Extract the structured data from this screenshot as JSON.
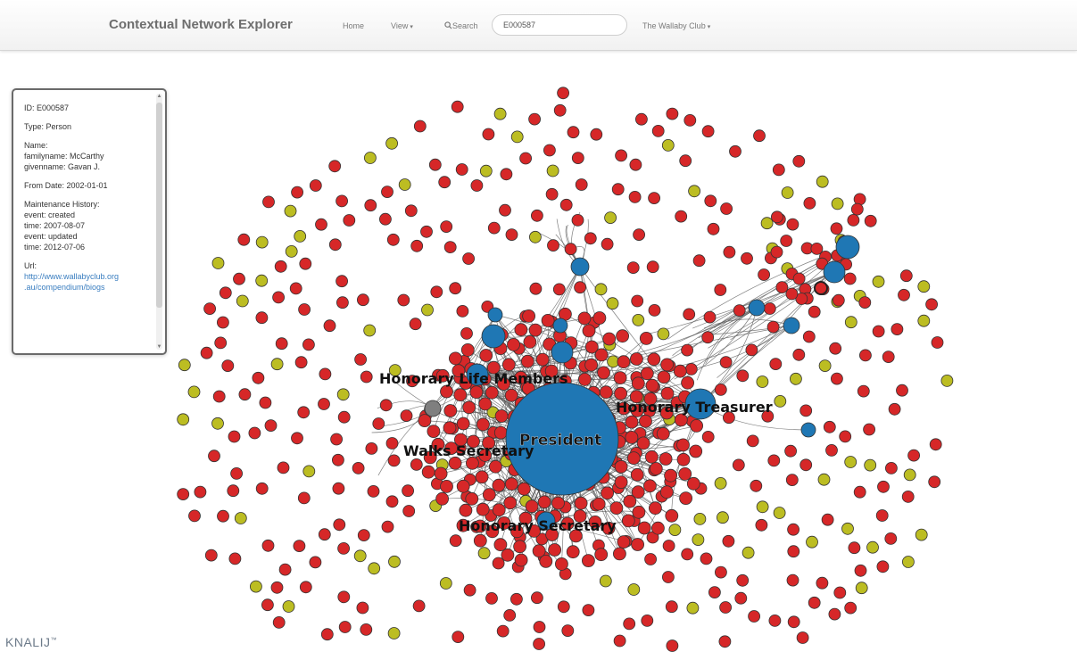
{
  "navbar": {
    "brand": "Contextual Network Explorer",
    "home_label": "Home",
    "view_label": "View",
    "search_label": "Search",
    "search_value": "E000587",
    "club_label": "The Wallaby Club"
  },
  "info_panel": {
    "id_line": "ID: E000587",
    "type_line": "Type: Person",
    "name_label": "Name:",
    "familyname_line": "familyname: McCarthy",
    "givenname_line": "givenname: Gavan J.",
    "from_date_line": "From Date: 2002-01-01",
    "history_label": "Maintenance History:",
    "event1_line": "event: created",
    "time1_line": "time: 2007-08-07",
    "event2_line": "event: updated",
    "time2_line": "time: 2012-07-06",
    "url_label": "Url:",
    "url_line1": "http://www.wallabyclub.org",
    "url_line2": ".au/compendium/biogs"
  },
  "graph": {
    "hub_labels": {
      "president": "President",
      "honorary_life_members": "Honorary Life Members",
      "honorary_treasurer": "Honorary Treasurer",
      "walks_secretary": "Walks Secretary",
      "honorary_secretary": "Honorary Secretary"
    },
    "colors": {
      "person": "#d62728",
      "other": "#bcbd22",
      "role": "#1f77b4",
      "selected": "#7f7f7f",
      "link": "#555555"
    }
  },
  "logo": {
    "text": "KNALIJ",
    "mark": "™"
  }
}
